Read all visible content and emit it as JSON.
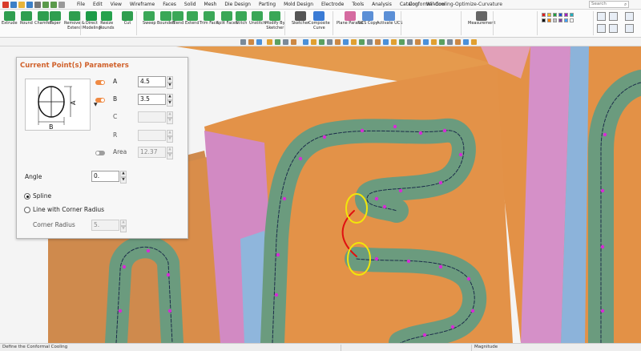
{
  "app": {
    "title": "Conformal-Cooling-Optimize-Curvature",
    "search_placeholder": "Search",
    "menus": [
      "File",
      "Edit",
      "View",
      "Wireframe",
      "Faces",
      "Solid",
      "Mesh",
      "Die Design",
      "Parting",
      "Mold Design",
      "Electrode",
      "Tools",
      "Analysis",
      "Catalog",
      "Window"
    ]
  },
  "ribbon": {
    "buttons": [
      {
        "label": "Extrude",
        "icon": "extrude-icon",
        "color": "#2f9e4f"
      },
      {
        "label": "Round",
        "icon": "round-icon",
        "color": "#2f9e4f"
      },
      {
        "label": "Chamfer",
        "icon": "chamfer-icon",
        "color": "#2f9e4f"
      },
      {
        "label": "Taper",
        "icon": "taper-icon",
        "color": "#2f9e4f"
      },
      {
        "label": "Remove &\nExtend",
        "icon": "remove-extend-icon",
        "color": "#2f9e4f"
      },
      {
        "label": "Direct\nModeling",
        "icon": "direct-modeling-icon",
        "color": "#1e9b48"
      },
      {
        "label": "Resize\nRounds",
        "icon": "resize-rounds-icon",
        "color": "#26a24d"
      },
      {
        "label": "Cut",
        "icon": "cut-icon",
        "color": "#2f9e4f"
      },
      {
        "label": "Sweep",
        "icon": "sweep-icon",
        "color": "#3aa757"
      },
      {
        "label": "Bounded",
        "icon": "bounded-icon",
        "color": "#3aa757"
      },
      {
        "label": "Blend",
        "icon": "blend-icon",
        "color": "#3aa757"
      },
      {
        "label": "Extend",
        "icon": "extend-icon",
        "color": "#3aa757"
      },
      {
        "label": "Trim Face",
        "icon": "trim-face-icon",
        "color": "#3aa757"
      },
      {
        "label": "Split Faces",
        "icon": "split-faces-icon",
        "color": "#3aa757"
      },
      {
        "label": "Stitch",
        "icon": "stitch-icon",
        "color": "#3aa757"
      },
      {
        "label": "Unstitch",
        "icon": "unstitch-icon",
        "color": "#3aa757"
      },
      {
        "label": "Modify By\nSketcher",
        "icon": "modify-by-sketcher-icon",
        "color": "#3aa757"
      },
      {
        "label": "Sketcher",
        "icon": "sketcher-icon",
        "color": "#555555"
      },
      {
        "label": "Composite\nCurve",
        "icon": "composite-curve-icon",
        "color": "#3a7bd5"
      },
      {
        "label": "Plane Parallel",
        "icon": "plane-parallel-icon",
        "color": "#d56aa0"
      },
      {
        "label": "UCS Copy",
        "icon": "ucs-copy-icon",
        "color": "#5b8fd6"
      },
      {
        "label": "Activate UCS",
        "icon": "activate-ucs-icon",
        "color": "#5b8fd6"
      },
      {
        "label": "Measurement",
        "icon": "measurement-icon",
        "color": "#666666"
      }
    ]
  },
  "panel": {
    "title": "Current Point(s) Parameters",
    "profile_icon": "ellipse-profile-icon",
    "params": [
      {
        "label": "A",
        "value": "4.5",
        "enabled": true,
        "toggle": "on"
      },
      {
        "label": "B",
        "value": "3.5",
        "enabled": true,
        "toggle": "on"
      },
      {
        "label": "C",
        "value": "",
        "enabled": false,
        "toggle": "none"
      },
      {
        "label": "R",
        "value": "",
        "enabled": false,
        "toggle": "none"
      },
      {
        "label": "Area",
        "value": "12.37",
        "enabled": false,
        "toggle": "off"
      }
    ],
    "angle_label": "Angle",
    "angle_value": "0.",
    "spline_label": "Spline",
    "line_label": "Line with Corner Radius",
    "corner_radius_label": "Corner Radius",
    "corner_radius_value": "5.",
    "selected_mode": "Spline"
  },
  "status": {
    "prompt": "Define the Conformal Cooling",
    "magnitude_label": "Magnitude"
  },
  "colors": {
    "accent": "#d0612b",
    "toggle_on": "#ef8a43",
    "mold_face": "#e09046",
    "pink_face": "#d58cc6",
    "blue_face": "#88b3d8",
    "pipe": "#6f9e80",
    "highlight_ellipse": "#f2e60a",
    "transition_curve": "#e01010",
    "path_point": "#d62bd6"
  }
}
